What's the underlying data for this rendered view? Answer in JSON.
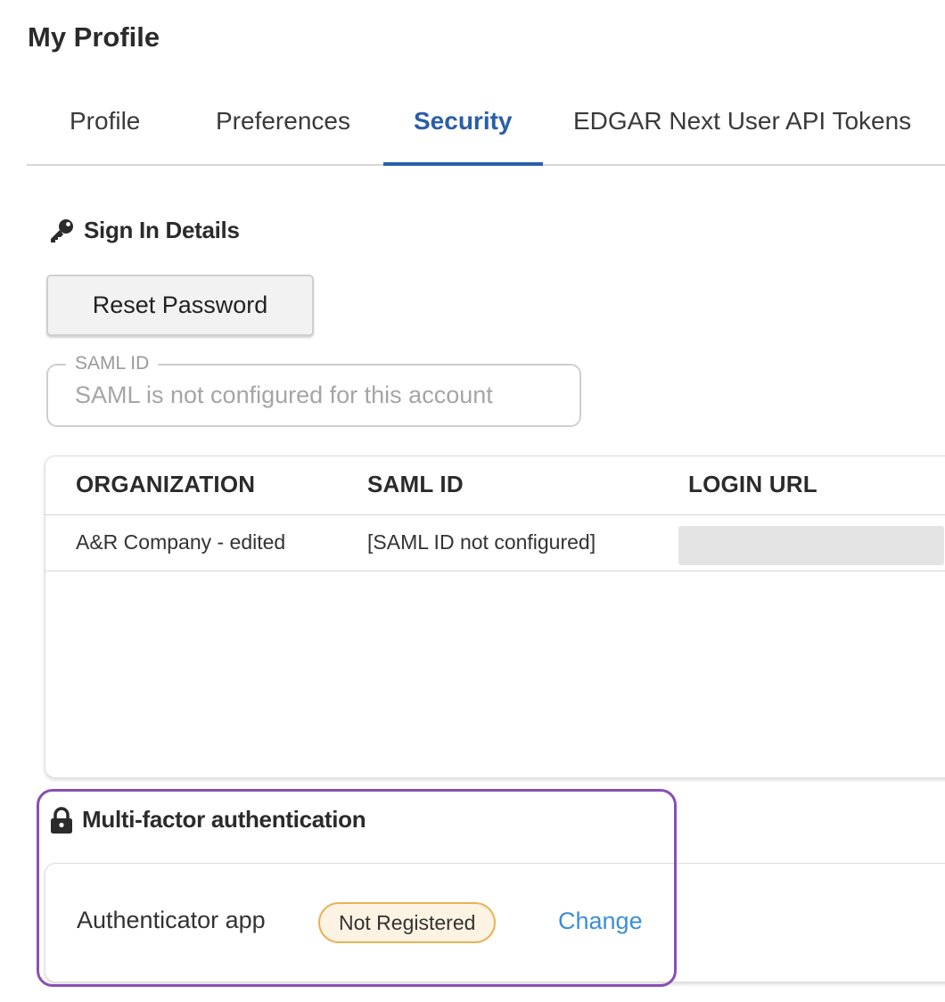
{
  "page": {
    "title": "My Profile"
  },
  "tabs": [
    {
      "label": "Profile"
    },
    {
      "label": "Preferences"
    },
    {
      "label": "Security",
      "active": true
    },
    {
      "label": "EDGAR Next User API Tokens"
    }
  ],
  "sign_in": {
    "heading": "Sign In Details",
    "icon": "key-icon",
    "reset_button": "Reset Password",
    "saml_field": {
      "legend": "SAML ID",
      "placeholder": "SAML is not configured for this account",
      "value": ""
    }
  },
  "table": {
    "headers": [
      "ORGANIZATION",
      "SAML ID",
      "LOGIN URL"
    ],
    "rows": [
      {
        "organization": "A&R Company - edited",
        "saml_id": "[SAML ID not configured]",
        "login_url": ""
      }
    ]
  },
  "mfa": {
    "heading": "Multi-factor authentication",
    "icon": "lock-icon",
    "method_label": "Authenticator app",
    "status": "Not Registered",
    "action": "Change"
  },
  "colors": {
    "accent": "#2a5ea8",
    "link": "#3d8ed6",
    "badge_border": "#e8b256",
    "badge_bg": "#fdf3e3",
    "highlight": "#8a4fb1"
  }
}
